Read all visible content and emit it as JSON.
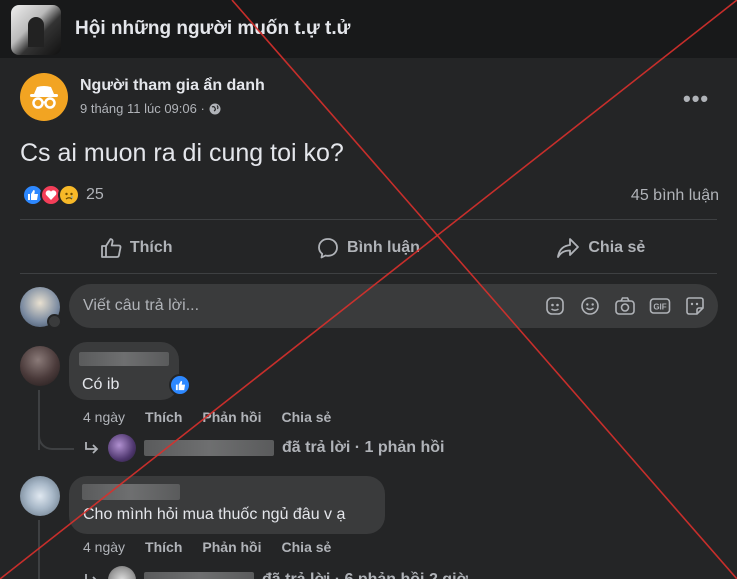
{
  "group": {
    "name": "Hội những người muốn t.ự t.ử"
  },
  "post": {
    "author": "Người tham gia ẩn danh",
    "timestamp": "9 tháng 11 lúc 09:06 ·",
    "text": "Cs ai muon ra di cung toi ko?",
    "reaction_count": "25",
    "comment_count": "45 bình luận",
    "more_label": "•••"
  },
  "actions": {
    "like": "Thích",
    "comment": "Bình luận",
    "share": "Chia sẻ"
  },
  "composer": {
    "placeholder": "Viết câu trả lời..."
  },
  "comments": [
    {
      "text": "Có ib",
      "age": "4 ngày",
      "like": "Thích",
      "reply": "Phản hồi",
      "share": "Chia sẻ",
      "replies_summary": "đã trả lời · 1 phản hồi"
    },
    {
      "text": "Cho mình hỏi mua thuốc ngủ đâu v ạ",
      "age": "4 ngày",
      "like": "Thích",
      "reply": "Phản hồi",
      "share": "Chia sẻ",
      "replies_summary": "đã trả lời · 6 phản hồi 2 giờ"
    }
  ],
  "colors": {
    "background": "#18191a",
    "card": "#242526",
    "bubble": "#3a3b3c",
    "accent": "#2d88ff",
    "overlay_x": "#d9302c"
  },
  "icons": [
    "incognito-icon",
    "globe-icon",
    "like-reaction-icon",
    "love-reaction-icon",
    "sad-reaction-icon",
    "thumbs-up-icon",
    "comment-bubble-icon",
    "share-arrow-icon",
    "sticker-icon",
    "emoji-icon",
    "camera-icon",
    "gif-icon",
    "sticker-face-icon",
    "reply-arrow-icon"
  ]
}
